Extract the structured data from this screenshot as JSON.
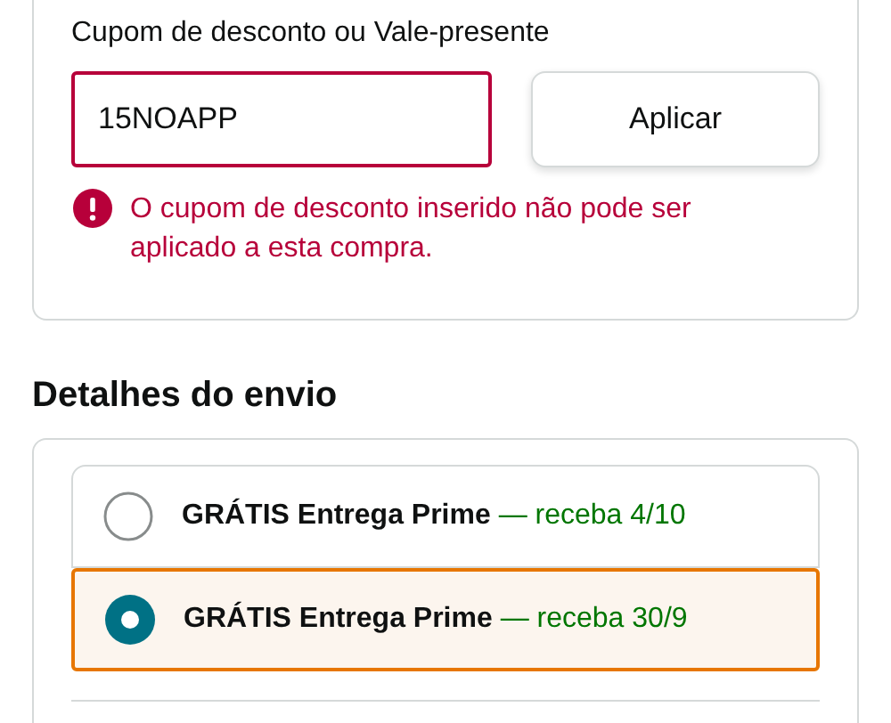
{
  "coupon": {
    "label": "Cupom de desconto ou Vale-presente",
    "value": "15NOAPP",
    "invalid": true,
    "apply_button": "Aplicar",
    "error": "O cupom de desconto inserido não pode ser aplicado a esta compra."
  },
  "shipping": {
    "title": "Detalhes do envio",
    "options": [
      {
        "name": "GRÁTIS Entrega Prime",
        "date": "— receba 4/10",
        "selected": false
      },
      {
        "name": "GRÁTIS Entrega Prime",
        "date": "— receba 30/9",
        "selected": true
      }
    ]
  }
}
